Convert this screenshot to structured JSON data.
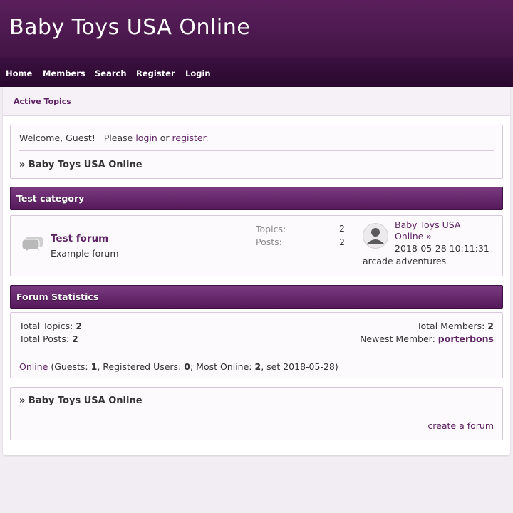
{
  "header": {
    "site_title": "Baby Toys USA Online"
  },
  "nav": {
    "home": "Home",
    "members": "Members",
    "search": "Search",
    "register": "Register",
    "login": "Login"
  },
  "subbar": {
    "active_topics": "Active Topics"
  },
  "welcome": {
    "prefix": "Welcome, Guest!   Please",
    "login": "login",
    "or": "or",
    "register": "register",
    "period": ".",
    "breadcrumb": "» Baby Toys USA Online"
  },
  "category": {
    "title": "Test category",
    "forum": {
      "name": "Test forum",
      "description": "Example forum",
      "topics_label": "Topics:",
      "topics_value": "2",
      "posts_label": "Posts:",
      "posts_value": "2",
      "last_post_link_line1": "Baby Toys USA",
      "last_post_link_line2": "Online",
      "last_post_arrow": "»",
      "last_post_date": "2018-05-28 10:11:31 -",
      "last_post_author": "arcade adventures"
    }
  },
  "stats": {
    "title": "Forum Statistics",
    "total_topics_label": "Total Topics:",
    "total_topics_value": "2",
    "total_posts_label": "Total Posts:",
    "total_posts_value": "2",
    "total_members_label": "Total Members:",
    "total_members_value": "2",
    "newest_member_label": "Newest Member:",
    "newest_member_value": "porterbons",
    "online_link": "Online",
    "guests_label": "(Guests:",
    "guests_value": "1",
    "registered_label": ", Registered Users:",
    "registered_value": "0",
    "most_online_label": "; Most Online:",
    "most_online_value": "2",
    "most_online_date": ", set 2018-05-28)"
  },
  "footer": {
    "breadcrumb": "» Baby Toys USA Online",
    "create_forum": "create a forum"
  },
  "colors": {
    "header": "#4e1a51",
    "nav": "#2f0c33",
    "accent": "#5e2363",
    "page_bg": "#f2ecf3"
  }
}
